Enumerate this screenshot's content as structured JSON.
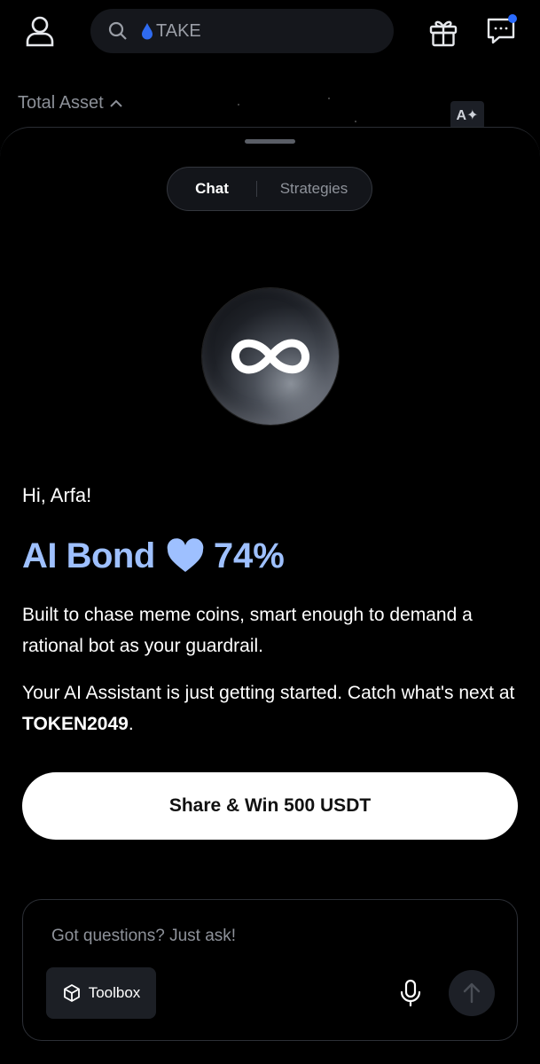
{
  "header": {
    "search": {
      "placeholder": "TAKE"
    },
    "total_asset_label": "Total Asset",
    "font_button_label": "A✦",
    "notification_dot_color": "#2a6bff"
  },
  "tabs": [
    {
      "label": "Chat",
      "active": true
    },
    {
      "label": "Strategies",
      "active": false
    }
  ],
  "assistant": {
    "greeting": "Hi, Arfa!",
    "bond_title": "AI Bond",
    "bond_percent": "74%",
    "accent_color": "#9ec0ff",
    "description": "Built to chase meme coins, smart enough to demand a rational bot as your guardrail.",
    "status_text": "Your AI Assistant is just getting started. Catch what's next at ",
    "event_name": "TOKEN2049",
    "status_suffix": "."
  },
  "share_button_label": "Share & Win 500 USDT",
  "composer": {
    "placeholder": "Got questions? Just ask!",
    "toolbox_label": "Toolbox"
  },
  "icons": {
    "profile": "user-icon",
    "search": "search-icon",
    "token": "drop-icon",
    "gift": "gift-icon",
    "chat": "message-icon",
    "orb": "infinity-icon",
    "heart": "heart-icon",
    "toolbox": "cube-icon",
    "mic": "microphone-icon",
    "send": "arrow-up-icon"
  }
}
